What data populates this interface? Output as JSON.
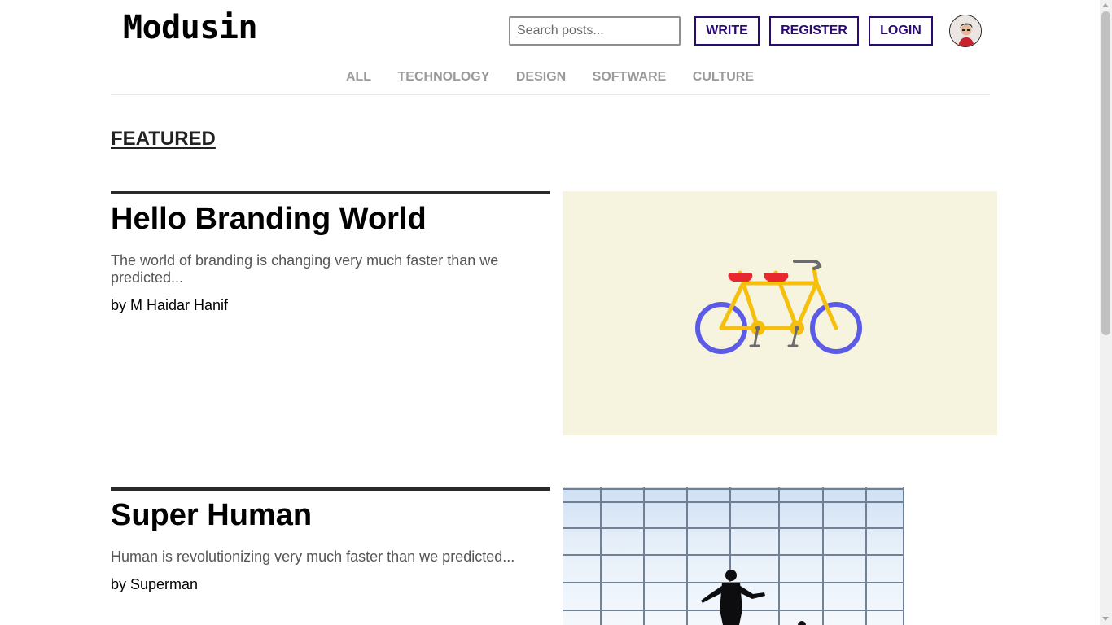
{
  "header": {
    "logo": "Modusin",
    "search": {
      "placeholder": "Search posts...",
      "value": ""
    },
    "buttons": {
      "write": "WRITE",
      "register": "REGISTER",
      "login": "LOGIN"
    }
  },
  "nav": {
    "items": [
      {
        "label": "ALL"
      },
      {
        "label": "TECHNOLOGY"
      },
      {
        "label": "DESIGN"
      },
      {
        "label": "SOFTWARE"
      },
      {
        "label": "CULTURE"
      }
    ]
  },
  "main": {
    "section_title": "FEATURED",
    "posts": [
      {
        "title": "Hello Branding World",
        "excerpt": "The world of branding is changing very much faster than we predicted...",
        "author": "by M Haidar Hanif",
        "image": "tandem-bicycle-illustration"
      },
      {
        "title": "Super Human",
        "excerpt": "Human is revolutionizing very much faster than we predicted...",
        "author": "by Superman",
        "image": "person-silhouette-grid-photo"
      }
    ]
  },
  "colors": {
    "accent": "#2a0a6e",
    "nav_text": "#9a9a9a",
    "image_bg": "#f6f3df",
    "bike_frame": "#f5bf0c",
    "bike_wheels": "#5b5be8",
    "bike_seats": "#e8282e"
  }
}
